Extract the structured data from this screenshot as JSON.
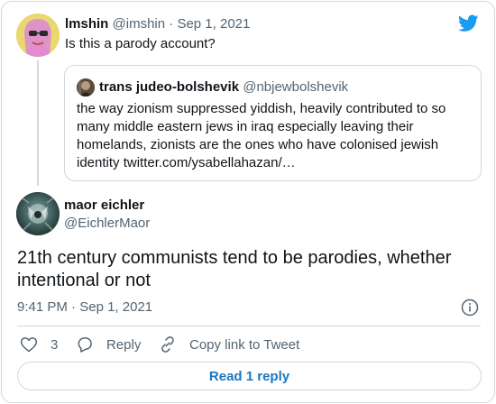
{
  "parent_tweet": {
    "name": "lmshin",
    "handle": "@imshin",
    "separator": "·",
    "date": "Sep 1, 2021",
    "text": "Is this a parody account?"
  },
  "quoted_tweet": {
    "name": "trans judeo-bolshevik",
    "handle": "@nbjewbolshevik",
    "text": "the way zionism suppressed yiddish, heavily contributed to so many middle eastern jews in iraq especially leaving their homelands, zionists are the ones who have colonised jewish identity twitter.com/ysabellahazan/…"
  },
  "main_tweet": {
    "name": "maor eichler",
    "handle": "@EichlerMaor",
    "text": "21th century communists tend to be parodies, whether intentional or not",
    "time": "9:41 PM",
    "separator": "·",
    "date": "Sep 1, 2021"
  },
  "actions": {
    "like_count": "3",
    "reply_label": "Reply",
    "copy_label": "Copy link to Tweet"
  },
  "read_replies_label": "Read 1 reply",
  "colors": {
    "brand": "#1d9bf0",
    "link": "#1d77c2",
    "secondary_text": "#536471",
    "border": "#cfd9de"
  },
  "icons": {
    "brand": "twitter-bird-icon",
    "info": "info-icon",
    "like": "heart-icon",
    "reply": "reply-bubble-icon",
    "copy": "link-icon"
  }
}
